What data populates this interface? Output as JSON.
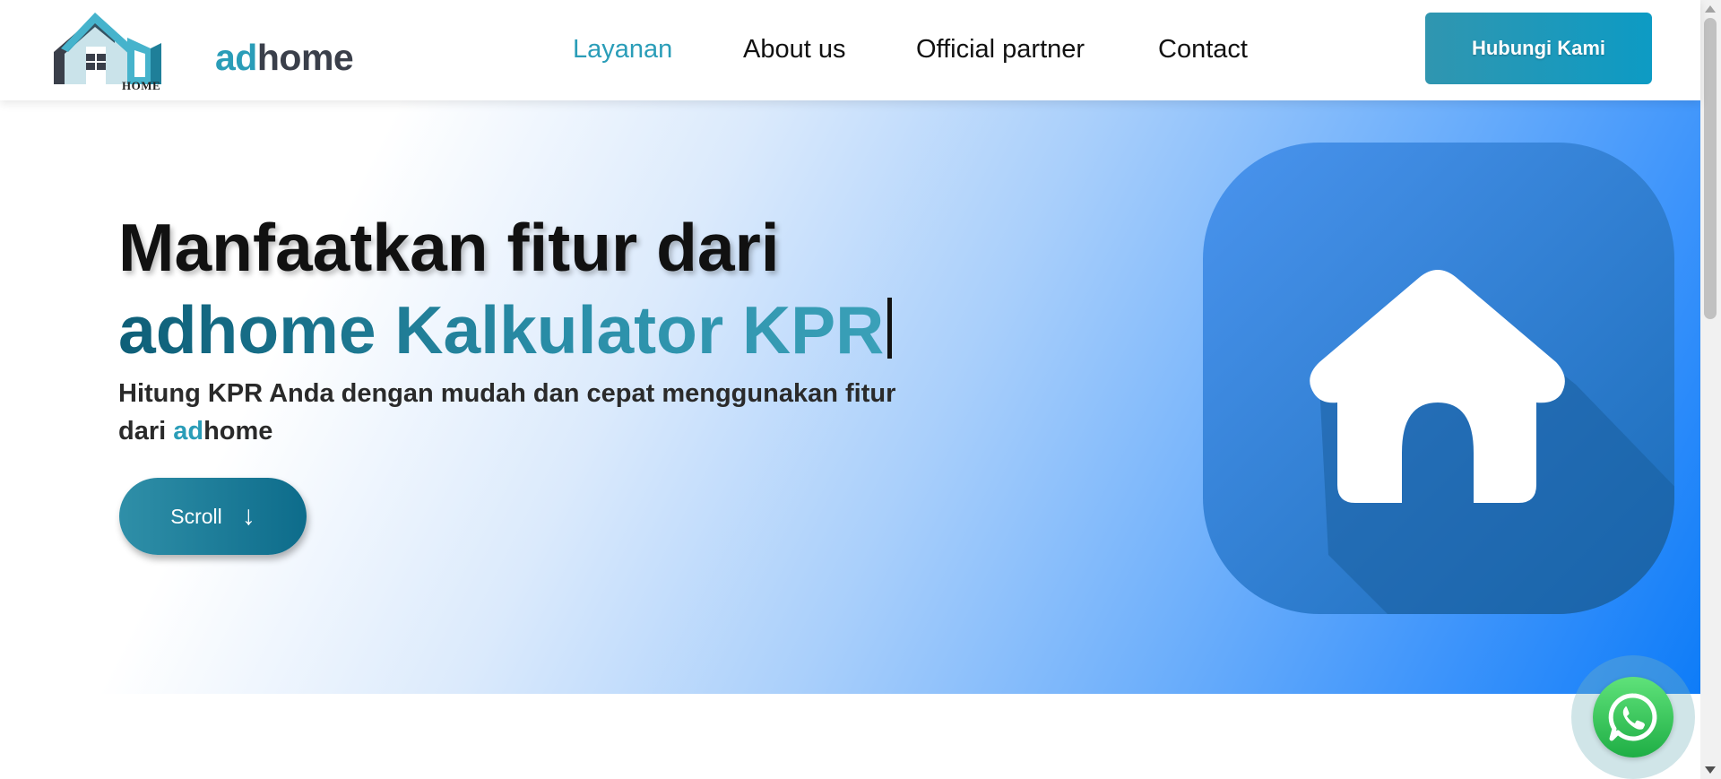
{
  "brand": {
    "logo_word_ad": "ad",
    "logo_word_home": "home",
    "logo_badge": "HOME"
  },
  "nav": {
    "items": [
      {
        "label": "Layanan",
        "active": true
      },
      {
        "label": "About us",
        "active": false
      },
      {
        "label": "Official partner",
        "active": false
      },
      {
        "label": "Contact",
        "active": false
      }
    ],
    "cta_label": "Hubungi Kami"
  },
  "hero": {
    "headline_line1": "Manfaatkan fitur dari",
    "headline_line2": "adhome Kalkulator KPR",
    "subtitle_prefix": "Hitung KPR Anda dengan mudah dan cepat menggunakan fitur dari ",
    "subtitle_ad": "ad",
    "subtitle_home": "home",
    "scroll_label": "Scroll",
    "scroll_arrow": "↓",
    "icon": "house-icon"
  },
  "floating": {
    "icon": "whatsapp-icon"
  },
  "colors": {
    "accent": "#2a9db8",
    "accent_dark": "#0d6c8b",
    "hero_blue": "#0e7cf8",
    "whatsapp": "#25d366"
  }
}
